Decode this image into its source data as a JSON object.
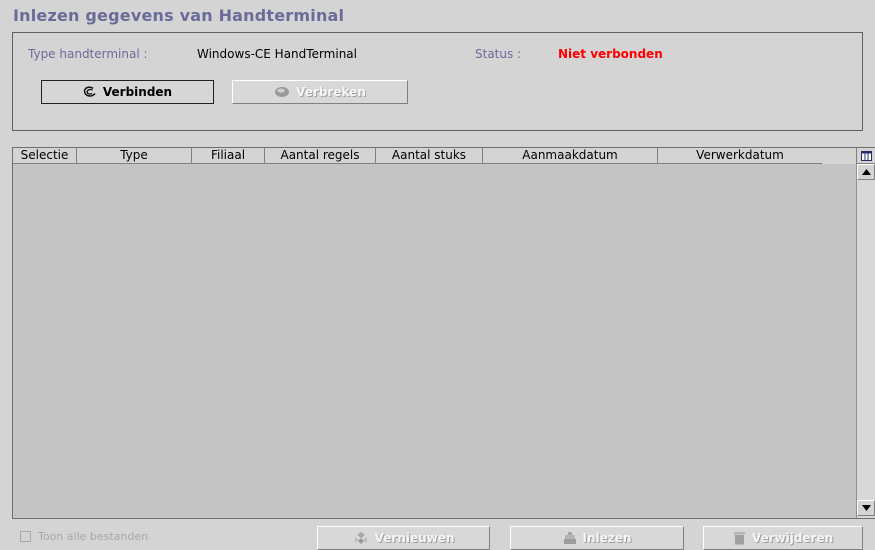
{
  "window": {
    "title": "Inlezen gegevens van Handterminal"
  },
  "connection": {
    "type_label": "Type handterminal :",
    "type_value": "Windows-CE HandTerminal",
    "status_label": "Status :",
    "status_value": "Niet verbonden",
    "connect_label": "Verbinden",
    "disconnect_label": "Verbreken",
    "status_color": "#ff0000"
  },
  "table": {
    "columns": [
      "Selectie",
      "Type",
      "Filiaal",
      "Aantal regels",
      "Aantal stuks",
      "Aanmaakdatum",
      "Verwerkdatum"
    ],
    "rows": []
  },
  "footer": {
    "show_all_label": "Toon alle bestanden",
    "show_all_checked": false,
    "refresh_label": "Vernieuwen",
    "import_label": "Inlezen",
    "delete_label": "Verwijderen"
  },
  "colors": {
    "title": "#6b6b9a",
    "background": "#d4d4d4",
    "grid": "#c4c4c4"
  }
}
